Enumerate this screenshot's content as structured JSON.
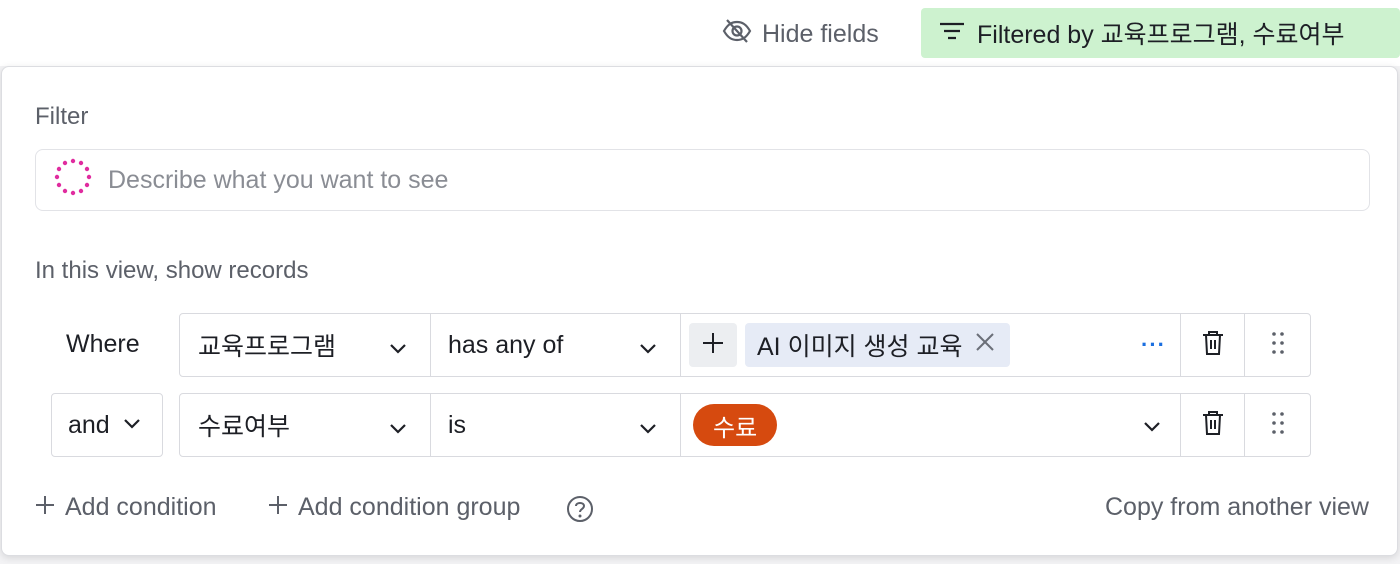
{
  "toolbar": {
    "hide_fields_label": "Hide fields",
    "filtered_label": "Filtered by 교육프로그램, 수료여부"
  },
  "filter_panel": {
    "title": "Filter",
    "ai_input_placeholder": "Describe what you want to see",
    "subtitle": "In this view, show records",
    "conditions": [
      {
        "conjunction": "Where",
        "field": "교육프로그램",
        "operator": "has any of",
        "values": [
          "AI 이미지 생성 교육"
        ]
      },
      {
        "conjunction": "and",
        "field": "수료여부",
        "operator": "is",
        "values": [
          "수료"
        ]
      }
    ],
    "more_label": "···",
    "add_condition_label": "Add condition",
    "add_condition_group_label": "Add condition group",
    "copy_label": "Copy from another view"
  },
  "colors": {
    "filtered_bg": "#cdf2cf",
    "chip_bg": "#e6ebf6",
    "pill_orange": "#d64a0f",
    "ai_icon": "#e02c9f",
    "link_blue": "#1b6fe0"
  },
  "icons": [
    "eye-slash-icon",
    "filter-lines-icon",
    "ai-sparkle-icon",
    "chevron-down-icon",
    "plus-icon",
    "close-icon",
    "trash-icon",
    "drag-handle-icon",
    "help-circle-icon"
  ]
}
